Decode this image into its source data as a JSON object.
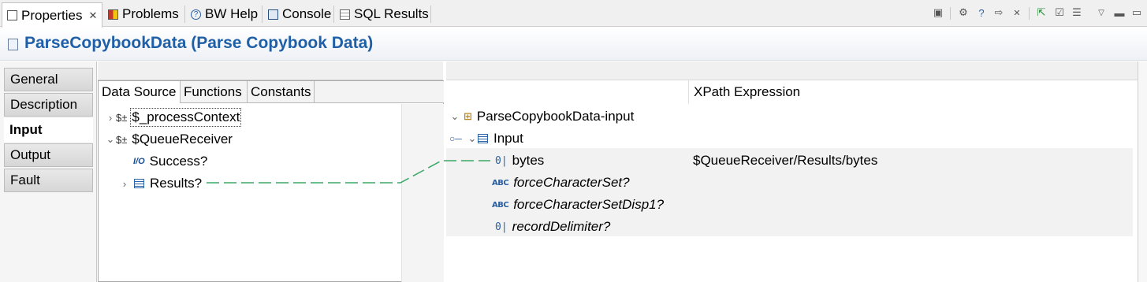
{
  "tabs": [
    {
      "label": "Properties",
      "icon": "properties-icon",
      "active": true,
      "close": "✕"
    },
    {
      "label": "Problems",
      "icon": "problems-icon"
    },
    {
      "label": "BW Help",
      "icon": "help-icon"
    },
    {
      "label": "Console",
      "icon": "console-icon"
    },
    {
      "label": "SQL Results",
      "icon": "sql-results-icon"
    }
  ],
  "title": "ParseCopybookData (Parse Copybook Data)",
  "nav": [
    "General",
    "Description",
    "Input",
    "Output",
    "Fault"
  ],
  "datasource": {
    "tabs": [
      "Data Source",
      "Functions",
      "Constants"
    ],
    "tree": [
      {
        "label": "$_processContext",
        "icon": "$±"
      },
      {
        "label": "$QueueReceiver",
        "icon": "$±"
      },
      {
        "label": "Success?",
        "icon": "I/O"
      },
      {
        "label": "Results?",
        "icon": "box"
      }
    ]
  },
  "mapping": {
    "column_header": "XPath Expression",
    "tree": [
      {
        "label": "ParseCopybookData-input"
      },
      {
        "label": "Input"
      },
      {
        "label": "bytes",
        "xpath": "$QueueReceiver/Results/bytes"
      },
      {
        "label": "forceCharacterSet?"
      },
      {
        "label": "forceCharacterSetDisp1?"
      },
      {
        "label": "recordDelimiter?"
      }
    ]
  },
  "colors": {
    "title": "#1f5fa8",
    "link_line": "#3aa866",
    "icon_blue": "#2a5fa0"
  }
}
